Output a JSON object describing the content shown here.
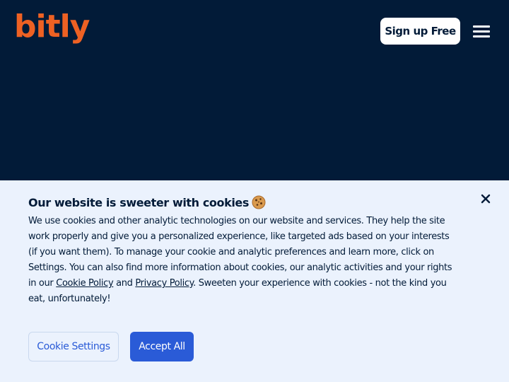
{
  "header": {
    "logo_text": "bitly",
    "signup_label": "Sign up Free",
    "menu_icon": "hamburger-menu-icon"
  },
  "cookie_banner": {
    "title": "Our website is sweeter with cookies",
    "title_icon": "cookie-icon",
    "close_icon": "close-icon",
    "body_part1": "We use cookies and other analytic technologies on our website and services. They help the site work properly and give you a personalized experience, like targeted ads based on your interests (if you want them). To manage your cookie and analytic preferences and learn more, click on Settings. You can also find more information about cookies, our analytic activities and your rights in our ",
    "cookie_policy_link": "Cookie Policy",
    "body_and": " and ",
    "privacy_policy_link": "Privacy Policy",
    "body_part2": ". Sweeten your experience with cookies - not the kind you eat, unfortunately!",
    "settings_label": "Cookie Settings",
    "accept_label": "Accept All"
  },
  "colors": {
    "header_bg": "#021b38",
    "brand_orange": "#ee6123",
    "banner_bg": "#ebf2fd",
    "accent_blue": "#2a5bd7"
  }
}
